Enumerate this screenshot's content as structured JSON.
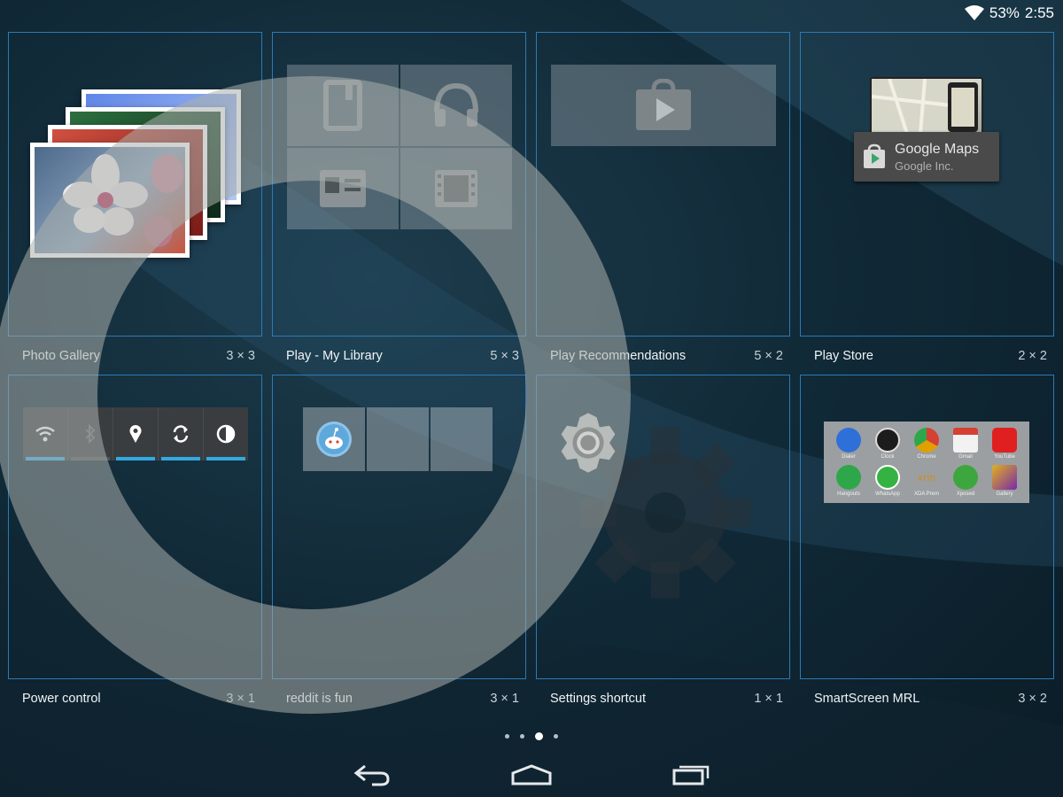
{
  "status_bar": {
    "battery": "53%",
    "time": "2:55",
    "icons": [
      "wifi-icon"
    ]
  },
  "widgets": [
    {
      "name": "Photo Gallery",
      "size": "3 × 3"
    },
    {
      "name": "Play - My Library",
      "size": "5 × 3"
    },
    {
      "name": "Play Recommendations",
      "size": "5 × 2"
    },
    {
      "name": "Play Store",
      "size": "2 × 2"
    },
    {
      "name": "Power control",
      "size": "3 × 1"
    },
    {
      "name": "reddit is fun",
      "size": "3 × 1"
    },
    {
      "name": "Settings shortcut",
      "size": "1 × 1"
    },
    {
      "name": "SmartScreen MRL",
      "size": "3 × 2"
    }
  ],
  "play_store_card": {
    "app_name": "Google Maps",
    "developer": "Google Inc."
  },
  "power_control": {
    "buttons": [
      "wifi-icon",
      "bluetooth-icon",
      "location-icon",
      "sync-icon",
      "brightness-icon"
    ],
    "active": [
      true,
      false,
      true,
      true,
      true
    ]
  },
  "smartscreen_apps": [
    {
      "label": "Dialer",
      "color": "#2f6fd8",
      "icon": "phone-icon"
    },
    {
      "label": "Clock",
      "color": "#1c1c1c",
      "icon": "clock-icon"
    },
    {
      "label": "Chrome",
      "color": "#e0a000",
      "icon": "chrome-icon"
    },
    {
      "label": "Gmail",
      "color": "#d64033",
      "icon": "gmail-icon"
    },
    {
      "label": "YouTube",
      "color": "#e02020",
      "icon": "youtube-icon"
    },
    {
      "label": "Hangouts",
      "color": "#2ea74a",
      "icon": "hangouts-icon"
    },
    {
      "label": "WhatsApp",
      "color": "#35b342",
      "icon": "whatsapp-icon"
    },
    {
      "label": "XDA Prem",
      "color": "#d08a20",
      "icon": "xda-icon"
    },
    {
      "label": "Xposed",
      "color": "#3ea63e",
      "icon": "android-icon"
    },
    {
      "label": "Gallery",
      "color": "#7a2aa8",
      "icon": "gallery-icon"
    }
  ],
  "smartscreen_xda_glyph": "xrin",
  "pager": {
    "count": 4,
    "active_index": 2
  },
  "nav": [
    "back-icon",
    "home-icon",
    "recents-icon"
  ],
  "colors": {
    "tile_border": "#2c7ab6",
    "power_active": "#33a9e0",
    "power_inactive": "#505456"
  }
}
